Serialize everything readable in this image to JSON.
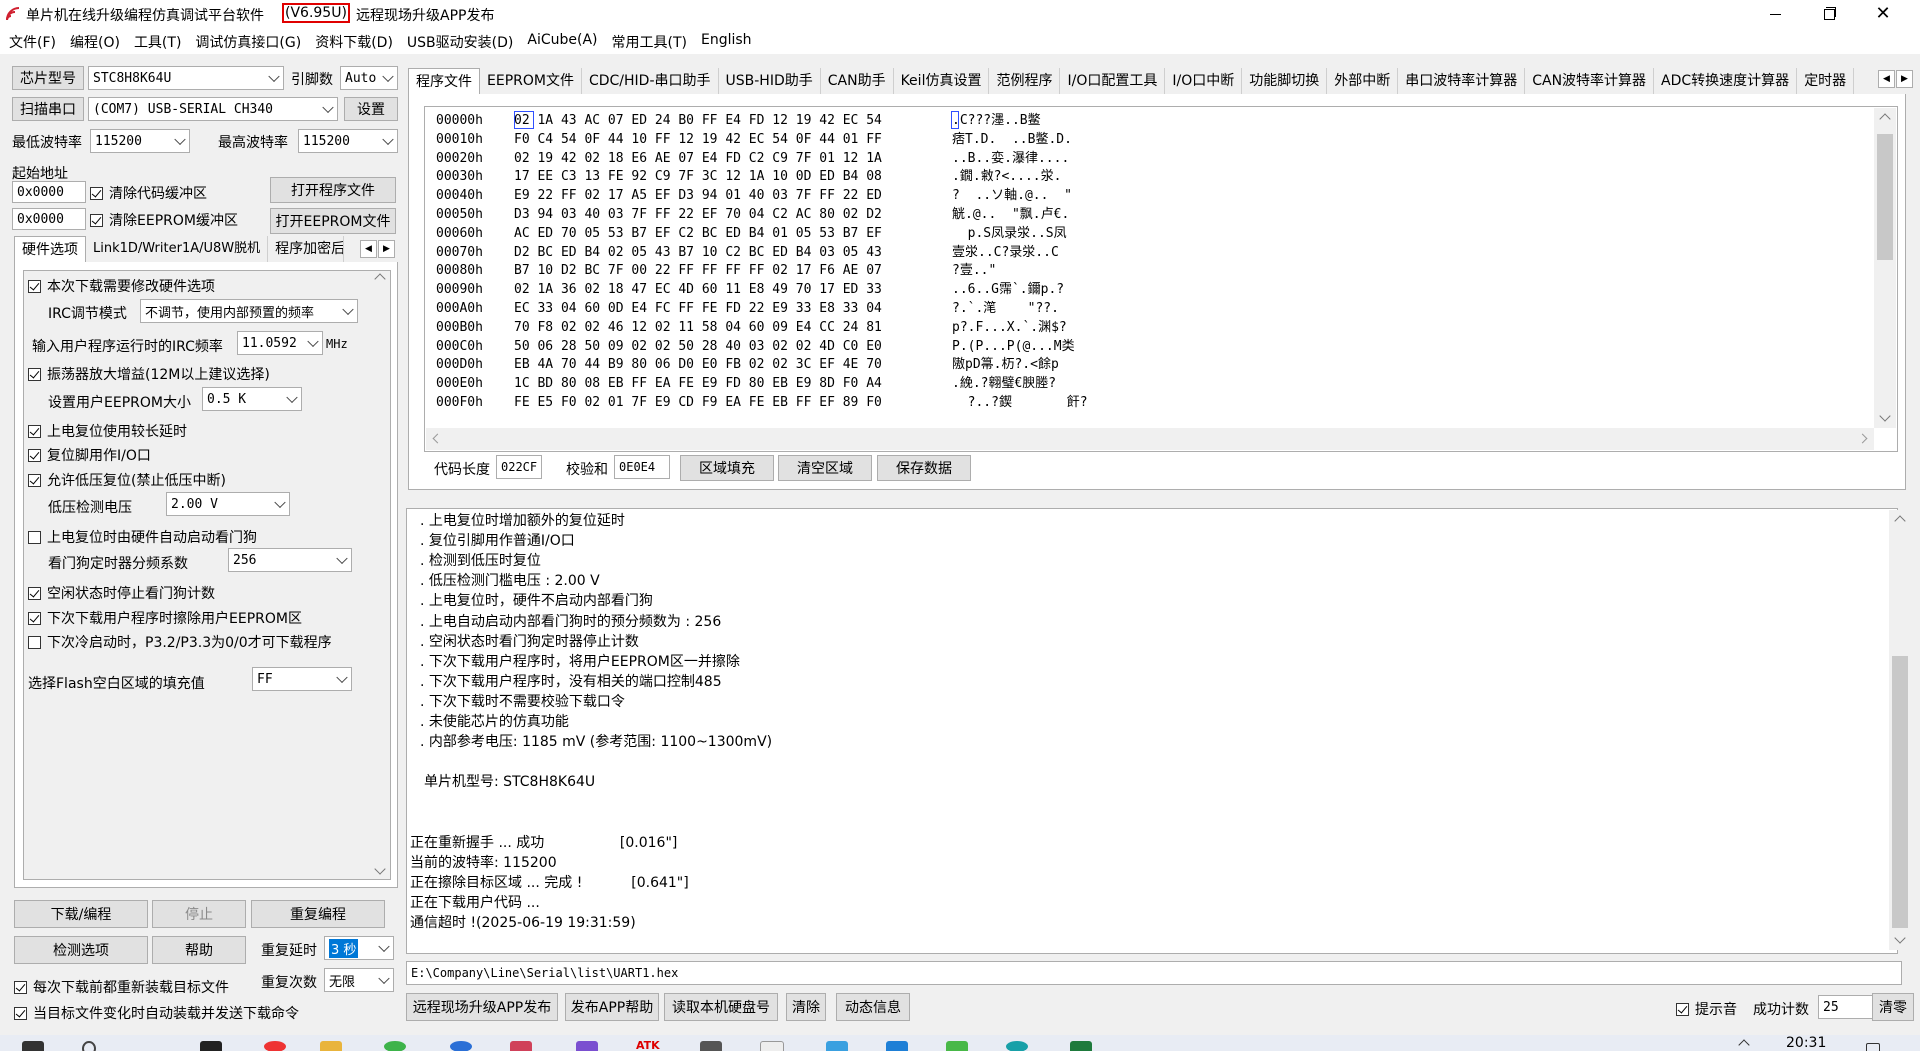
{
  "window": {
    "title_prefix": "单片机在线升级编程仿真调试平台软件",
    "version": "(V6.95U)",
    "title_suffix": "远程现场升级APP发布"
  },
  "menu": [
    "文件(F)",
    "编程(O)",
    "工具(T)",
    "调试仿真接口(G)",
    "资料下载(D)",
    "USB驱动安装(D)",
    "AiCube(A)",
    "常用工具(T)",
    "English"
  ],
  "left": {
    "chip_btn": "芯片型号",
    "chip_value": "STC8H8K64U",
    "pins_label": "引脚数",
    "pins_value": "Auto",
    "scan_btn": "扫描串口",
    "port_value": "(COM7) USB-SERIAL CH340",
    "settings_btn": "设置",
    "min_baud_label": "最低波特率",
    "min_baud_value": "115200",
    "max_baud_label": "最高波特率",
    "max_baud_value": "115200",
    "start_addr_label": "起始地址",
    "addr1": "0x0000",
    "clear_code": "清除代码缓冲区",
    "open_prog_btn": "打开程序文件",
    "addr2": "0x0000",
    "clear_eeprom": "清除EEPROM缓冲区",
    "open_eeprom_btn": "打开EEPROM文件",
    "tabs": [
      "硬件选项",
      "Link1D/Writer1A/U8W脱机",
      "程序加密后"
    ],
    "hw": {
      "opt1": "本次下载需要修改硬件选项",
      "irc_mode_label": "IRC调节模式",
      "irc_mode_value": "不调节，使用内部预置的频率",
      "irc_freq_label": "输入用户程序运行时的IRC频率",
      "irc_freq_value": "11.0592",
      "irc_freq_unit": "MHz",
      "opt2": "振荡器放大增益(12M以上建议选择)",
      "eeprom_size_label": "设置用户EEPROM大小",
      "eeprom_size_value": "0.5 K",
      "opt3": "上电复位使用较长延时",
      "opt4": "复位脚用作I/O口",
      "opt5": "允许低压复位(禁止低压中断)",
      "lvd_label": "低压检测电压",
      "lvd_value": "2.00 V",
      "opt6": "上电复位时由硬件自动启动看门狗",
      "wdt_label": "看门狗定时器分频系数",
      "wdt_value": "256",
      "opt7": "空闲状态时停止看门狗计数",
      "opt8": "下次下载用户程序时擦除用户EEPROM区",
      "opt9": "下次冷启动时，P3.2/P3.3为0/0才可下载程序",
      "fill_label": "选择Flash空白区域的填充值",
      "fill_value": "FF"
    },
    "download_btn": "下载/编程",
    "stop_btn": "停止",
    "reprogram_btn": "重复编程",
    "check_btn": "检测选项",
    "help_btn": "帮助",
    "repeat_delay_label": "重复延时",
    "repeat_delay_value": "3 秒",
    "repeat_count_label": "重复次数",
    "repeat_count_value": "无限",
    "reload_each": "每次下载前都重新装载目标文件",
    "auto_reload": "当目标文件变化时自动装载并发送下载命令"
  },
  "right": {
    "tabs": [
      "程序文件",
      "EEPROM文件",
      "CDC/HID-串口助手",
      "USB-HID助手",
      "CAN助手",
      "Keil仿真设置",
      "范例程序",
      "I/O口配置工具",
      "I/O口中断",
      "功能脚切换",
      "外部中断",
      "串口波特率计算器",
      "CAN波特率计算器",
      "ADC转换速度计算器",
      "定时器"
    ],
    "hex_rows": [
      {
        "addr": "00000h",
        "bytes": "02 1A 43 AC 07 ED 24 B0 FF E4 FD 12 19 42 EC 54",
        "ascii": ".C???濹..B鳖"
      },
      {
        "addr": "00010h",
        "bytes": "F0 C4 54 0F 44 10 FF 12 19 42 EC 54 0F 44 01 FF",
        "ascii": "痞T.D.  ..B鳖.D."
      },
      {
        "addr": "00020h",
        "bytes": "02 19 42 02 18 E6 AE 07 E4 FD C2 C9 7F 01 12 1A",
        "ascii": "..B..娈.瀑律...."
      },
      {
        "addr": "00030h",
        "bytes": "17 EE C3 13 FE 92 C9 7F 3C 12 1A 10 0D ED B4 08",
        "ascii": ".鐗.敹?<....泶."
      },
      {
        "addr": "00040h",
        "bytes": "E9 22 FF 02 17 A5 EF D3 94 01 40 03 7F FF 22 ED",
        "ascii": "?  ..ソ軸.@..  \""
      },
      {
        "addr": "00050h",
        "bytes": "D3 94 03 40 03 7F FF 22 EF 70 04 C2 AC 80 02 D2",
        "ascii": "觥.@..  \"飘.卢€."
      },
      {
        "addr": "00060h",
        "bytes": "AC ED 70 05 53 B7 EF C2 BC ED B4 01 05 53 B7 EF",
        "ascii": "  p.S凤录泶..S凤"
      },
      {
        "addr": "00070h",
        "bytes": "D2 BC ED B4 02 05 43 B7 10 C2 BC ED B4 03 05 43",
        "ascii": "壹泶..C?录泶..C"
      },
      {
        "addr": "00080h",
        "bytes": "B7 10 D2 BC 7F 00 22 FF FF FF FF 02 17 F6 AE 07",
        "ascii": "?壹..\"          "
      },
      {
        "addr": "00090h",
        "bytes": "02 1A 36 02 18 47 EC 4D 60 11 E8 49 70 17 ED 33",
        "ascii": "..6..G霈`.鑈p.?"
      },
      {
        "addr": "000A0h",
        "bytes": "EC 33 04 60 0D E4 FC FF FE FD 22 E9 33 E8 33 04",
        "ascii": "?.`.滗    \"??."
      },
      {
        "addr": "000B0h",
        "bytes": "70 F8 02 02 46 12 02 11 58 04 60 09 E4 CC 24 81",
        "ascii": "p?.F...X.`.渊$?"
      },
      {
        "addr": "000C0h",
        "bytes": "50 06 28 50 09 02 02 50 28 40 03 02 02 4D C0 E0",
        "ascii": "P.(P...P(@...M类"
      },
      {
        "addr": "000D0h",
        "bytes": "EB 4A 70 44 B9 80 06 D0 E0 FB 02 02 3C EF 4E 70",
        "ascii": "隞pD箒.杤?.<餘p"
      },
      {
        "addr": "000E0h",
        "bytes": "1C BD 80 08 EB FF EA FE E9 FD 80 EB E9 8D F0 A4",
        "ascii": ".絻.?翱璧€腴塍?"
      },
      {
        "addr": "000F0h",
        "bytes": "FE E5 F0 02 01 7F E9 CD F9 EA FE EB FF EF 89 F0",
        "ascii": "  ?..?鍥       飦?"
      }
    ],
    "code_len_label": "代码长度",
    "code_len_value": "022CF",
    "checksum_label": "校验和",
    "checksum_value": "0E0E4",
    "fill_btn": "区域填充",
    "clear_btn": "清空区域",
    "save_btn": "保存数据",
    "log_lines": [
      ". 上电复位时增加额外的复位延时",
      ". 复位引脚用作普通I/O口",
      ". 检测到低压时复位",
      ". 低压检测门槛电压 : 2.00 V",
      ". 上电复位时，硬件不启动内部看门狗",
      ". 上电自动启动内部看门狗时的预分频数为 : 256",
      ". 空闲状态时看门狗定时器停止计数",
      ". 下次下载用户程序时，将用户EEPROM区一并擦除",
      ". 下次下载用户程序时，没有相关的端口控制485",
      ". 下次下载时不需要校验下载口令",
      ". 未使能芯片的仿真功能",
      ". 内部参考电压: 1185 mV (参考范围: 1100~1300mV)",
      "",
      "单片机型号: STC8H8K64U",
      "",
      "",
      "正在重新握手 ... 成功                 [0.016\"]",
      "当前的波特率: 115200",
      "正在擦除目标区域 ... 完成 !           [0.641\"]",
      "正在下载用户代码 ...",
      "通信超时 !(2025-06-19 19:31:59)"
    ],
    "file_path": "E:\\Company\\Line\\Serial\\list\\UART1.hex",
    "remote_btn": "远程现场升级APP发布",
    "publish_help_btn": "发布APP帮助",
    "read_disk_btn": "读取本机硬盘号",
    "clear_log_btn": "清除",
    "dynamic_btn": "动态信息",
    "beep_label": "提示音",
    "success_label": "成功计数",
    "success_value": "25",
    "clear_count_btn": "清零"
  },
  "taskbar": {
    "time": "20:31"
  }
}
